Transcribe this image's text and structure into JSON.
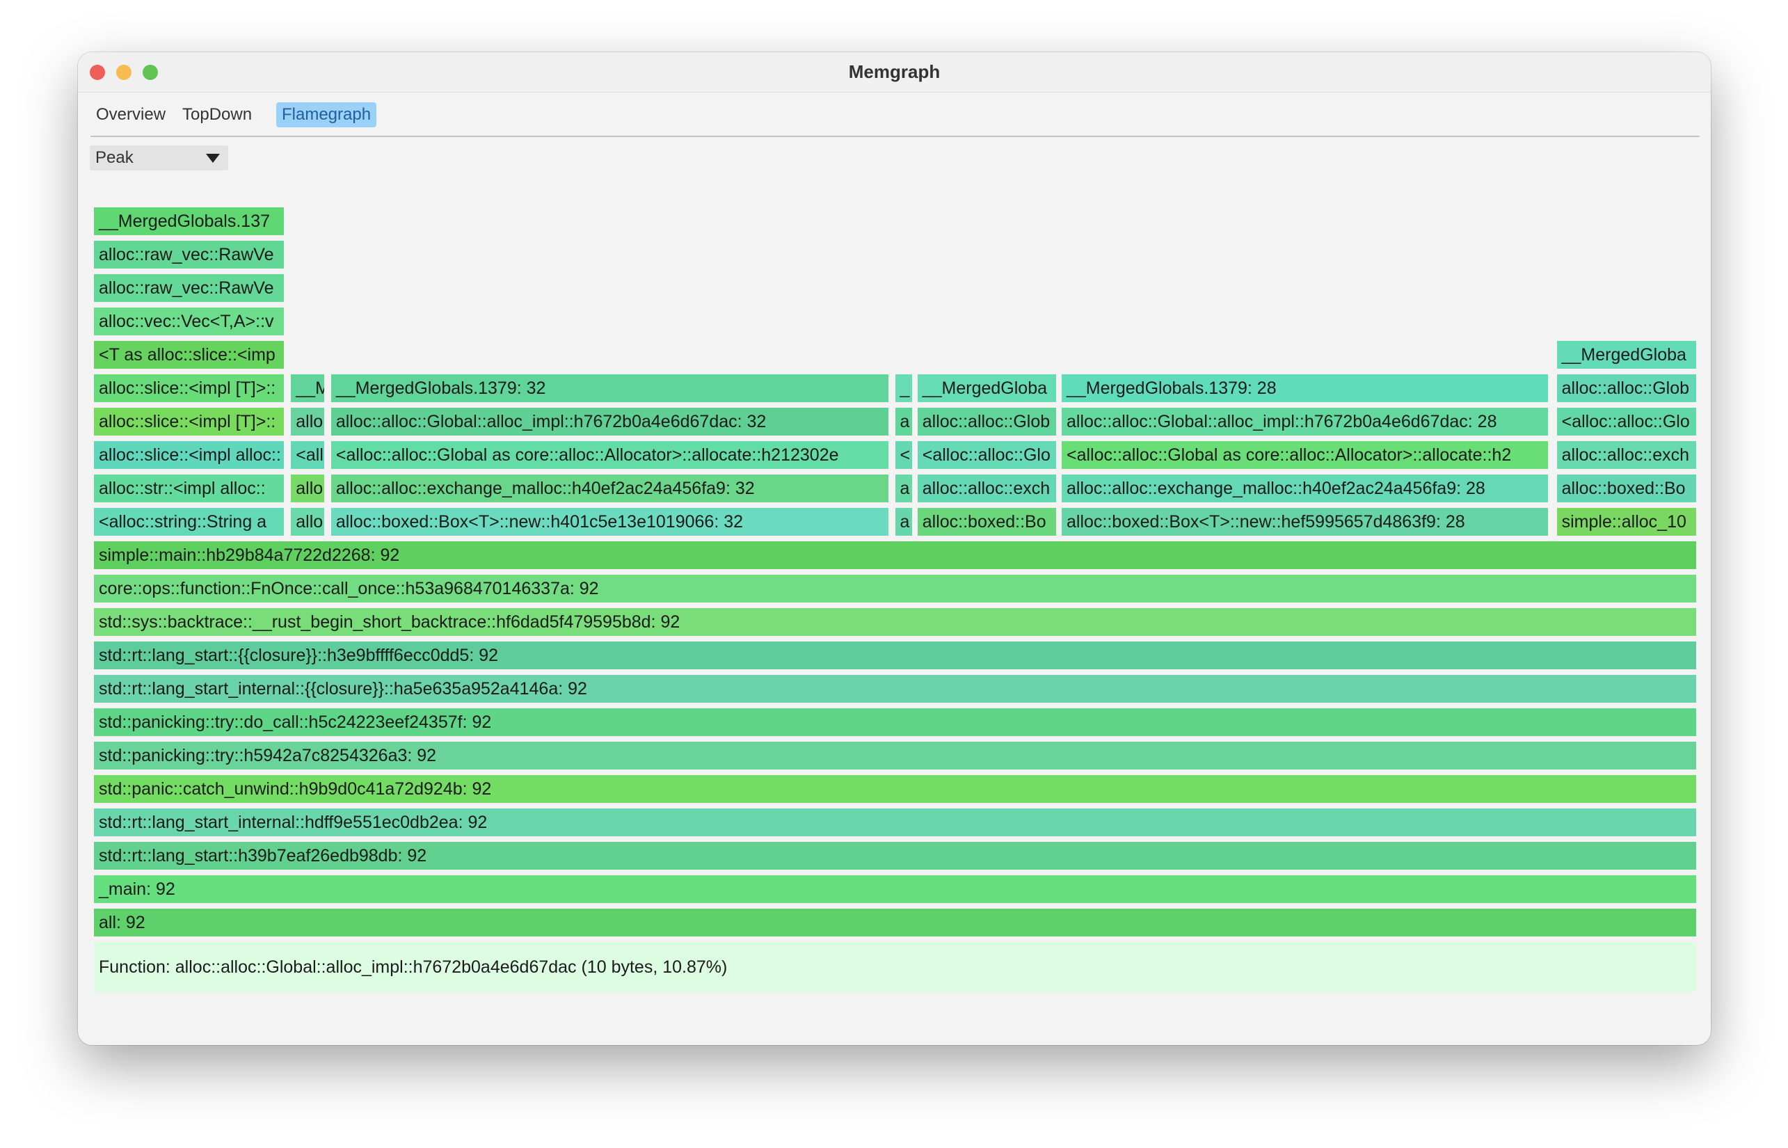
{
  "window": {
    "title": "Memgraph"
  },
  "tabs": [
    "Overview",
    "TopDown",
    "Flamegraph"
  ],
  "active_tab": "Flamegraph",
  "dropdown": {
    "value": "Peak"
  },
  "flamegraph": {
    "rows": [
      {
        "level": 21,
        "cells": [
          {
            "span": [
              0,
              0.12
            ],
            "label": "__MergedGlobals.137",
            "color": "#5fd873"
          }
        ]
      },
      {
        "level": 20,
        "cells": [
          {
            "span": [
              0,
              0.12
            ],
            "label": "alloc::raw_vec::RawVe",
            "color": "#62d694"
          }
        ]
      },
      {
        "level": 19,
        "cells": [
          {
            "span": [
              0,
              0.12
            ],
            "label": "alloc::raw_vec::RawVe",
            "color": "#63d897"
          }
        ]
      },
      {
        "level": 18,
        "cells": [
          {
            "span": [
              0,
              0.12
            ],
            "label": "alloc::vec::Vec<T,A>::v",
            "color": "#6bdd8b"
          }
        ]
      },
      {
        "level": 17,
        "cells": [
          {
            "span": [
              0,
              0.12
            ],
            "label": "<T as alloc::slice::<imp",
            "color": "#66d35e"
          },
          {
            "span": [
              0.913,
              1.0
            ],
            "label": "__MergedGloba",
            "color": "#63dbb6"
          }
        ]
      },
      {
        "level": 16,
        "cells": [
          {
            "span": [
              0,
              0.12
            ],
            "label": "alloc::slice::<impl [T]>::",
            "color": "#67dc78"
          },
          {
            "span": [
              0.123,
              0.145
            ],
            "label": "__M",
            "color": "#61d49a"
          },
          {
            "span": [
              0.148,
              0.497
            ],
            "label": "__MergedGlobals.1379: 32",
            "color": "#5fd59a"
          },
          {
            "span": [
              0.5,
              0.512
            ],
            "label": "_",
            "color": "#66dbb4"
          },
          {
            "span": [
              0.514,
              0.602
            ],
            "label": "__MergedGloba",
            "color": "#66dcb5"
          },
          {
            "span": [
              0.604,
              0.909
            ],
            "label": "__MergedGlobals.1379: 28",
            "color": "#5fdcba"
          },
          {
            "span": [
              0.913,
              1.0
            ],
            "label": "alloc::alloc::Glob",
            "color": "#63d7b6"
          }
        ]
      },
      {
        "level": 15,
        "cells": [
          {
            "span": [
              0,
              0.12
            ],
            "label": "alloc::slice::<impl [T]>::",
            "color": "#79db5e"
          },
          {
            "span": [
              0.123,
              0.145
            ],
            "label": "allo",
            "color": "#6ad2a0"
          },
          {
            "span": [
              0.148,
              0.497
            ],
            "label": "alloc::alloc::Global::alloc_impl::h7672b0a4e6d67dac: 32",
            "color": "#5fcf93"
          },
          {
            "span": [
              0.5,
              0.512
            ],
            "label": "a",
            "color": "#61d699"
          },
          {
            "span": [
              0.514,
              0.602
            ],
            "label": "alloc::alloc::Glob",
            "color": "#61d49b"
          },
          {
            "span": [
              0.604,
              0.909
            ],
            "label": "alloc::alloc::Global::alloc_impl::h7672b0a4e6d67dac: 28",
            "color": "#63d89f"
          },
          {
            "span": [
              0.913,
              1.0
            ],
            "label": "<alloc::alloc::Glo",
            "color": "#62d7a8"
          }
        ]
      },
      {
        "level": 14,
        "cells": [
          {
            "span": [
              0,
              0.12
            ],
            "label": "alloc::slice::<impl alloc::",
            "color": "#5fd7bb"
          },
          {
            "span": [
              0.123,
              0.145
            ],
            "label": "<all",
            "color": "#63d8b6"
          },
          {
            "span": [
              0.148,
              0.497
            ],
            "label": "<alloc::alloc::Global as core::alloc::Allocator>::allocate::h212302e",
            "color": "#63dca5"
          },
          {
            "span": [
              0.5,
              0.512
            ],
            "label": "<",
            "color": "#64d8b1"
          },
          {
            "span": [
              0.514,
              0.602
            ],
            "label": "<alloc::alloc::Glo",
            "color": "#66d9b5"
          },
          {
            "span": [
              0.604,
              0.909
            ],
            "label": "<alloc::alloc::Global as core::alloc::Allocator>::allocate::h2",
            "color": "#69dd76"
          },
          {
            "span": [
              0.913,
              1.0
            ],
            "label": "alloc::alloc::exch",
            "color": "#69dab0"
          }
        ]
      },
      {
        "level": 13,
        "cells": [
          {
            "span": [
              0,
              0.12
            ],
            "label": "alloc::str::<impl alloc::",
            "color": "#63db9d"
          },
          {
            "span": [
              0.123,
              0.145
            ],
            "label": "allo",
            "color": "#78db67"
          },
          {
            "span": [
              0.148,
              0.497
            ],
            "label": "alloc::alloc::exchange_malloc::h40ef2ac24a456fa9: 32",
            "color": "#6ad68a"
          },
          {
            "span": [
              0.5,
              0.512
            ],
            "label": "a",
            "color": "#66d9a6"
          },
          {
            "span": [
              0.514,
              0.602
            ],
            "label": "alloc::alloc::exch",
            "color": "#64d7b3"
          },
          {
            "span": [
              0.604,
              0.909
            ],
            "label": "alloc::alloc::exchange_malloc::h40ef2ac24a456fa9: 28",
            "color": "#64d9b3"
          },
          {
            "span": [
              0.913,
              1.0
            ],
            "label": "alloc::boxed::Bo",
            "color": "#64d6b1"
          }
        ]
      },
      {
        "level": 12,
        "cells": [
          {
            "span": [
              0,
              0.12
            ],
            "label": "<alloc::string::String a",
            "color": "#63d9b5"
          },
          {
            "span": [
              0.123,
              0.145
            ],
            "label": "allo",
            "color": "#6ad9ac"
          },
          {
            "span": [
              0.148,
              0.497
            ],
            "label": "alloc::boxed::Box<T>::new::h401c5e13e1019066: 32",
            "color": "#6adbbe"
          },
          {
            "span": [
              0.5,
              0.512
            ],
            "label": "a",
            "color": "#66d6ad"
          },
          {
            "span": [
              0.514,
              0.602
            ],
            "label": "alloc::boxed::Bo",
            "color": "#6ad77d"
          },
          {
            "span": [
              0.604,
              0.909
            ],
            "label": "alloc::boxed::Box<T>::new::hef5995657d4863f9: 28",
            "color": "#67d4a8"
          },
          {
            "span": [
              0.913,
              1.0
            ],
            "label": "simple::alloc_10",
            "color": "#7ad862"
          }
        ]
      },
      {
        "level": 11,
        "cells": [
          {
            "span": [
              0,
              1
            ],
            "label": "simple::main::hb29b84a7722d2268: 92",
            "color": "#5fcf5f"
          }
        ]
      },
      {
        "level": 10,
        "cells": [
          {
            "span": [
              0,
              1
            ],
            "label": "core::ops::function::FnOnce::call_once::h53a968470146337a: 92",
            "color": "#72dc82"
          }
        ]
      },
      {
        "level": 9,
        "cells": [
          {
            "span": [
              0,
              1
            ],
            "label": "std::sys::backtrace::__rust_begin_short_backtrace::hf6dad5f479595b8d: 92",
            "color": "#79dd7a"
          }
        ]
      },
      {
        "level": 8,
        "cells": [
          {
            "span": [
              0,
              1
            ],
            "label": "std::rt::lang_start::{{closure}}::h3e9bffff6ecc0dd5: 92",
            "color": "#5fcc9c"
          }
        ]
      },
      {
        "level": 7,
        "cells": [
          {
            "span": [
              0,
              1
            ],
            "label": "std::rt::lang_start_internal::{{closure}}::ha5e635a952a4146a: 92",
            "color": "#6ad3ab"
          }
        ]
      },
      {
        "level": 6,
        "cells": [
          {
            "span": [
              0,
              1
            ],
            "label": "std::panicking::try::do_call::h5c24223eef24357f: 92",
            "color": "#5fd687"
          }
        ]
      },
      {
        "level": 5,
        "cells": [
          {
            "span": [
              0,
              1
            ],
            "label": "std::panicking::try::h5942a7c8254326a3: 92",
            "color": "#69d39a"
          }
        ]
      },
      {
        "level": 4,
        "cells": [
          {
            "span": [
              0,
              1
            ],
            "label": "std::panic::catch_unwind::h9b9d0c41a72d924b: 92",
            "color": "#73dc62"
          }
        ]
      },
      {
        "level": 3,
        "cells": [
          {
            "span": [
              0,
              1
            ],
            "label": "std::rt::lang_start_internal::hdff9e551ec0db2ea: 92",
            "color": "#6ad6ad"
          }
        ]
      },
      {
        "level": 2,
        "cells": [
          {
            "span": [
              0,
              1
            ],
            "label": "std::rt::lang_start::h39b7eaf26edb98db: 92",
            "color": "#62d08e"
          }
        ]
      },
      {
        "level": 1,
        "cells": [
          {
            "span": [
              0,
              1
            ],
            "label": "_main: 92",
            "color": "#66e07f"
          }
        ]
      },
      {
        "level": 0,
        "cells": [
          {
            "span": [
              0,
              1
            ],
            "label": "all: 92",
            "color": "#5fd16a"
          }
        ]
      }
    ]
  },
  "status": {
    "text": "Function: alloc::alloc::Global::alloc_impl::h7672b0a4e6d67dac (10 bytes,  10.87%)"
  }
}
